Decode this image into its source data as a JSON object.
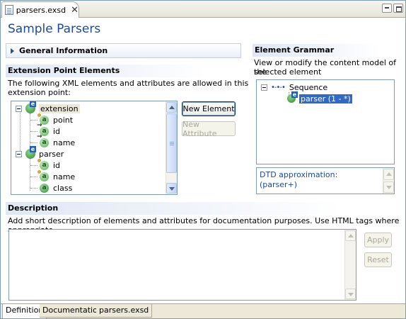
{
  "editor_tab": {
    "label": "parsers.exsd"
  },
  "page_title": "Sample Parsers",
  "general_info": {
    "label": "General Information"
  },
  "elements_section": {
    "title": "Extension Point Elements",
    "description_line1": "The following XML elements and attributes are allowed in this",
    "description_line2": "extension point:",
    "tree": [
      {
        "label": "extension",
        "kind": "element",
        "icon": "element-icon",
        "selected": true
      },
      {
        "label": "point",
        "kind": "attribute",
        "icon": "attribute-icon"
      },
      {
        "label": "id",
        "kind": "attribute",
        "icon": "attribute-icon"
      },
      {
        "label": "name",
        "kind": "attribute",
        "icon": "attribute-icon"
      },
      {
        "label": "parser",
        "kind": "element",
        "icon": "element-icon"
      },
      {
        "label": "id",
        "kind": "attribute",
        "icon": "attribute-icon"
      },
      {
        "label": "name",
        "kind": "attribute",
        "icon": "attribute-icon"
      },
      {
        "label": "class",
        "kind": "attribute",
        "icon": "attribute-icon"
      }
    ],
    "new_element_label": "New Element",
    "new_attribute_label": "New Attribute"
  },
  "grammar_section": {
    "title": "Element Grammar",
    "description_line1": "View or modify the content model of the",
    "description_line2": "selected element",
    "tree": [
      {
        "label": "Sequence",
        "icon": "sequence-icon"
      },
      {
        "label": "parser (1 - *)",
        "icon": "element-ref-icon",
        "selected": true
      }
    ],
    "dtd_line1": "DTD approximation:",
    "dtd_line2": "(parser+)"
  },
  "description_section": {
    "title": "Description",
    "text": "Add short description of elements and attributes for documentation purposes. Use HTML tags where appropriate.",
    "apply_label": "Apply",
    "reset_label": "Reset"
  },
  "bottom_tabs": [
    {
      "label": "Definition",
      "active": true
    },
    {
      "label": "Documentation"
    },
    {
      "label": "parsers.exsd"
    }
  ],
  "colors": {
    "title_blue": "#1c4a9c",
    "selection": "#316ac5",
    "section_gradient": "#dfe7f5"
  }
}
